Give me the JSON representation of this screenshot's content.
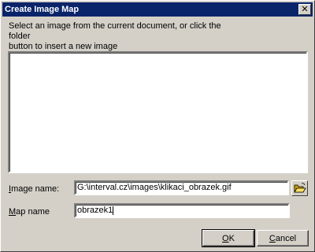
{
  "window": {
    "title": "Create Image Map",
    "close_glyph": "✕"
  },
  "instructions": "Select an image from the current document, or click the folder\nbutton to insert a new image",
  "form": {
    "image_name_label_mnemonic": "I",
    "image_name_label_rest": "mage name:",
    "image_name_value": "G:\\interval.cz\\images\\klikaci_obrazek.gif",
    "map_name_label_mnemonic": "M",
    "map_name_label_rest": "ap name",
    "map_name_value": "obrazek1"
  },
  "buttons": {
    "ok_mnemonic": "O",
    "ok_rest": "K",
    "cancel_mnemonic": "C",
    "cancel_rest": "ancel"
  },
  "icons": {
    "browse": "folder-open-icon"
  }
}
